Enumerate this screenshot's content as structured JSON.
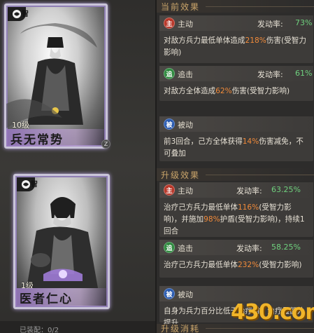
{
  "cards": [
    {
      "tag": "智",
      "level": "10级",
      "name": "兵无常势",
      "badge": "Z"
    },
    {
      "tag": "智",
      "level": "1级",
      "name": "医者仁心"
    }
  ],
  "bottom_text": "已装配：0/2",
  "current": {
    "title": "当前效果",
    "skills": [
      {
        "icon": "主",
        "type": "主动",
        "rate_label": "发动率:",
        "rate": "73%",
        "desc": [
          "对敌方兵力最低单体造成",
          "218%",
          "伤害(受智力影响)"
        ]
      },
      {
        "icon": "追",
        "type": "追击",
        "rate_label": "发动率:",
        "rate": "61%",
        "desc": [
          "对敌方全体造成",
          "62%",
          "伤害(受智力影响)"
        ]
      },
      {
        "icon": "被",
        "type": "被动",
        "desc": [
          "前3回合，己方全体获得",
          "14%",
          "伤害减免，不可叠加"
        ]
      }
    ]
  },
  "upgrade": {
    "title": "升级效果",
    "skills": [
      {
        "icon": "主",
        "type": "主动",
        "rate_label": "发动率:",
        "rate": "63.25%",
        "desc": [
          "治疗己方兵力最低单体",
          "116%",
          "(受智力影响)，并施加",
          "98%",
          "护盾(受智力影响)，持续1回合"
        ]
      },
      {
        "icon": "追",
        "type": "追击",
        "rate_label": "发动率:",
        "rate": "58.25%",
        "desc": [
          "治疗己方兵力最低单体",
          "232%",
          "(受智力影响)"
        ]
      },
      {
        "icon": "被",
        "type": "被动",
        "desc": [
          "自身为兵力百分比低于",
          "",
          "治疗时，治疗量额外提升"
        ]
      }
    ]
  },
  "upgrade_consume": {
    "title": "升级消耗"
  },
  "watermark": "430.com"
}
